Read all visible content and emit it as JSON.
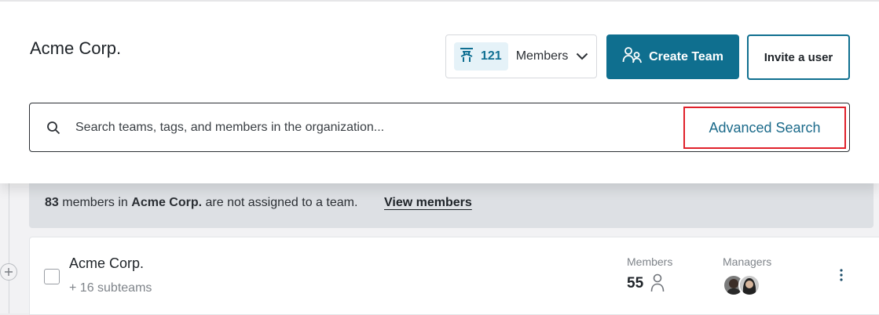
{
  "header": {
    "title": "Acme Corp.",
    "members_count": "121",
    "members_label": "Members",
    "create_team_label": "Create Team",
    "invite_label": "Invite a user"
  },
  "search": {
    "placeholder": "Search teams, tags, and members in the organization...",
    "advanced_label": "Advanced Search"
  },
  "notice": {
    "count": "83",
    "text_1": " members in ",
    "org": "Acme Corp.",
    "text_2": " are not assigned to a team.",
    "link": "View members"
  },
  "team_row": {
    "name": "Acme Corp.",
    "subteams": "+ 16 subteams",
    "members_header": "Members",
    "members_count": "55",
    "managers_header": "Managers"
  },
  "colors": {
    "primary": "#0f6f8f",
    "highlight_border": "#e0212b",
    "link": "#1b6a8a",
    "notice_bg": "#dde0e4"
  },
  "icons": [
    "team-roster-icon",
    "chevron-down-icon",
    "users-icon",
    "search-icon",
    "expand-plus-icon",
    "person-icon",
    "kebab-menu-icon"
  ]
}
